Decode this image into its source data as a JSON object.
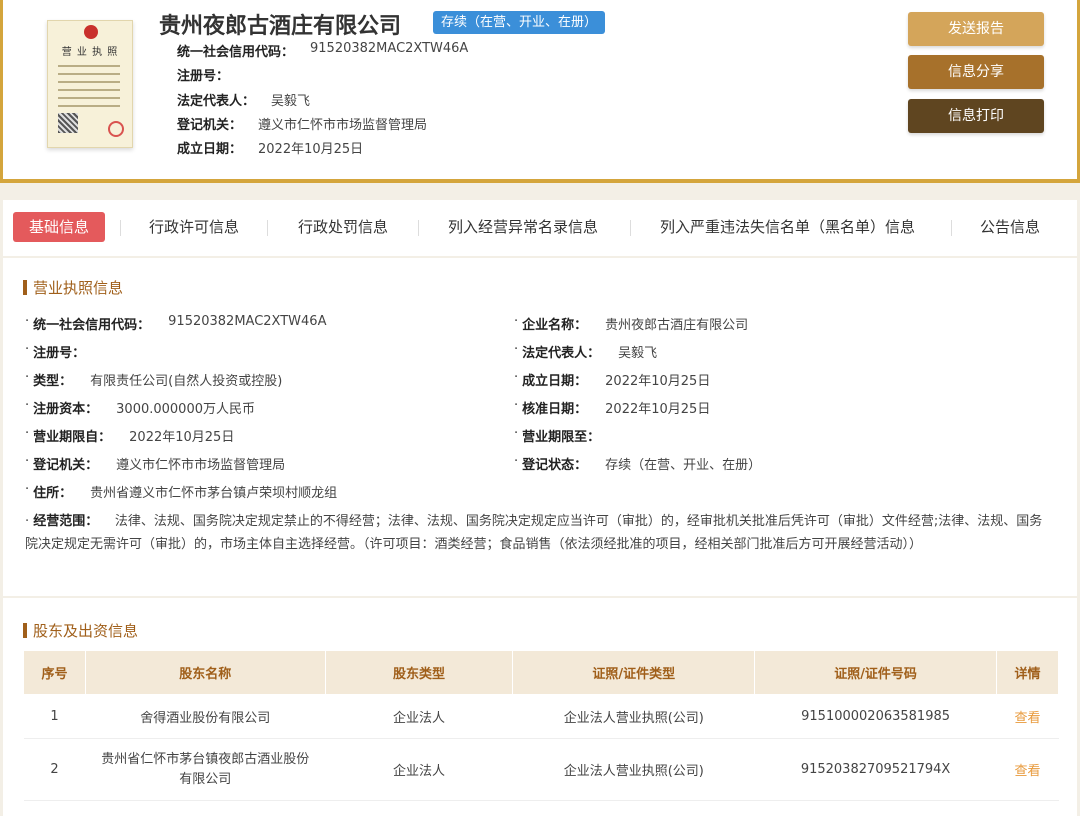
{
  "header": {
    "company_name": "贵州夜郎古酒庄有限公司",
    "status": "存续（在营、开业、在册）",
    "license_thumb_title": "营 业 执 照",
    "rows": [
      {
        "k": "统一社会信用代码：",
        "v": "91520382MAC2XTW46A"
      },
      {
        "k": "注册号：",
        "v": ""
      },
      {
        "k": "法定代表人：",
        "v": "吴毅飞"
      },
      {
        "k": "登记机关：",
        "v": "遵义市仁怀市市场监督管理局"
      },
      {
        "k": "成立日期：",
        "v": "2022年10月25日"
      }
    ],
    "buttons": {
      "send": "发送报告",
      "share": "信息分享",
      "print": "信息打印"
    }
  },
  "tabs": [
    "基础信息",
    "行政许可信息",
    "行政处罚信息",
    "列入经营异常名录信息",
    "列入严重违法失信名单（黑名单）信息",
    "公告信息"
  ],
  "license_section": {
    "title": "营业执照信息",
    "left": [
      {
        "k": "统一社会信用代码：",
        "v": "91520382MAC2XTW46A"
      },
      {
        "k": "注册号：",
        "v": ""
      },
      {
        "k": "类型：",
        "v": "有限责任公司(自然人投资或控股)"
      },
      {
        "k": "注册资本：",
        "v": "3000.000000万人民币"
      },
      {
        "k": "营业期限自：",
        "v": "2022年10月25日"
      },
      {
        "k": "登记机关：",
        "v": "遵义市仁怀市市场监督管理局"
      },
      {
        "k": "住所：",
        "v": "贵州省遵义市仁怀市茅台镇卢荣坝村顺龙组"
      }
    ],
    "right": [
      {
        "k": "企业名称：",
        "v": "贵州夜郎古酒庄有限公司"
      },
      {
        "k": "法定代表人：",
        "v": "吴毅飞"
      },
      {
        "k": "成立日期：",
        "v": "2022年10月25日"
      },
      {
        "k": "核准日期：",
        "v": "2022年10月25日"
      },
      {
        "k": "营业期限至：",
        "v": ""
      },
      {
        "k": "登记状态：",
        "v": "存续（在营、开业、在册）"
      }
    ],
    "scope_label": "经营范围：",
    "scope_text": "法律、法规、国务院决定规定禁止的不得经营；法律、法规、国务院决定规定应当许可（审批）的，经审批机关批准后凭许可（审批）文件经营;法律、法规、国务院决定规定无需许可（审批）的，市场主体自主选择经营。（许可项目：酒类经营；食品销售（依法须经批准的项目，经相关部门批准后方可开展经营活动））"
  },
  "shareholders": {
    "title": "股东及出资信息",
    "headers": [
      "序号",
      "股东名称",
      "股东类型",
      "证照/证件类型",
      "证照/证件号码",
      "详情"
    ],
    "rows": [
      {
        "no": "1",
        "name": "舍得酒业股份有限公司",
        "type": "企业法人",
        "cert_type": "企业法人营业执照(公司)",
        "cert_no": "915100002063581985",
        "detail": "查看"
      },
      {
        "no": "2",
        "name": "贵州省仁怀市茅台镇夜郎古酒业股份有限公司",
        "type": "企业法人",
        "cert_type": "企业法人营业执照(公司)",
        "cert_no": "91520382709521794X",
        "detail": "查看"
      }
    ]
  }
}
